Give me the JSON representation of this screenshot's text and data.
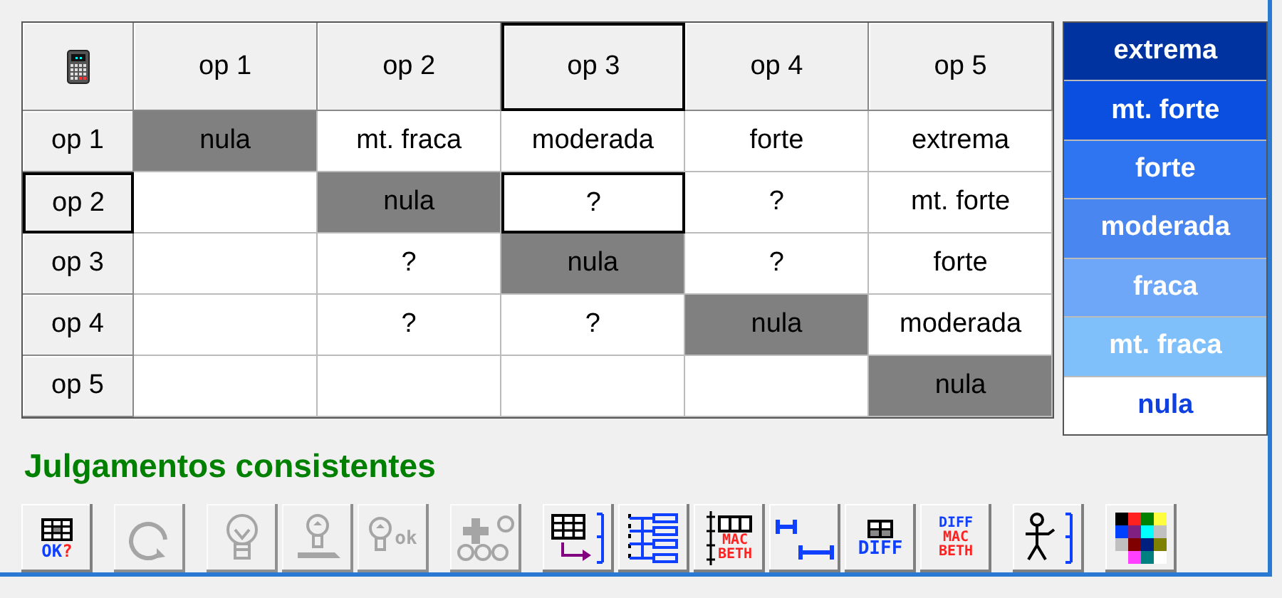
{
  "matrix": {
    "columns": [
      {
        "label": "op 1",
        "selected": false
      },
      {
        "label": "op 2",
        "selected": false
      },
      {
        "label": "op 3",
        "selected": true
      },
      {
        "label": "op 4",
        "selected": false
      },
      {
        "label": "op 5",
        "selected": false
      }
    ],
    "rows": [
      {
        "label": "op 1",
        "selected": false,
        "cells": [
          {
            "text": "nula",
            "shaded": true,
            "selected": false
          },
          {
            "text": "mt. fraca",
            "shaded": false,
            "selected": false
          },
          {
            "text": "moderada",
            "shaded": false,
            "selected": false
          },
          {
            "text": "forte",
            "shaded": false,
            "selected": false
          },
          {
            "text": "extrema",
            "shaded": false,
            "selected": false
          }
        ]
      },
      {
        "label": "op 2",
        "selected": true,
        "cells": [
          {
            "shaded": false,
            "selected": false
          },
          {
            "text": "nula",
            "shaded": true,
            "selected": false
          },
          {
            "text": "?",
            "shaded": false,
            "selected": true
          },
          {
            "text": "?",
            "shaded": false,
            "selected": false
          },
          {
            "text": "mt. forte",
            "shaded": false,
            "selected": false
          }
        ]
      },
      {
        "label": "op 3",
        "selected": false,
        "cells": [
          {
            "shaded": false,
            "selected": false
          },
          {
            "text": "?",
            "shaded": false,
            "selected": false
          },
          {
            "text": "nula",
            "shaded": true,
            "selected": false
          },
          {
            "text": "?",
            "shaded": false,
            "selected": false
          },
          {
            "text": "forte",
            "shaded": false,
            "selected": false
          }
        ]
      },
      {
        "label": "op 4",
        "selected": false,
        "cells": [
          {
            "shaded": false,
            "selected": false
          },
          {
            "text": "?",
            "shaded": false,
            "selected": false
          },
          {
            "text": "?",
            "shaded": false,
            "selected": false
          },
          {
            "text": "nula",
            "shaded": true,
            "selected": false
          },
          {
            "text": "moderada",
            "shaded": false,
            "selected": false
          }
        ]
      },
      {
        "label": "op 5",
        "selected": false,
        "cells": [
          {
            "shaded": false,
            "selected": false
          },
          {
            "shaded": false,
            "selected": false
          },
          {
            "shaded": false,
            "selected": false
          },
          {
            "shaded": false,
            "selected": false
          },
          {
            "text": "nula",
            "shaded": true,
            "selected": false
          }
        ]
      }
    ]
  },
  "scale": [
    {
      "label": "extrema",
      "color": "#0033a0"
    },
    {
      "label": "mt. forte",
      "color": "#0a4fe0"
    },
    {
      "label": "forte",
      "color": "#2f74f0"
    },
    {
      "label": "moderada",
      "color": "#4a86f0"
    },
    {
      "label": "fraca",
      "color": "#6ea6f8"
    },
    {
      "label": "mt. fraca",
      "color": "#80c0fa"
    },
    {
      "label": "nula",
      "color": "#ffffff"
    }
  ],
  "status": "Julgamentos consistentes",
  "toolbar": [
    [
      {
        "kind": "grid-ok",
        "disabled": false,
        "caption": [
          "OK",
          "?"
        ]
      }
    ],
    [
      {
        "kind": "refresh",
        "disabled": true
      }
    ],
    [
      {
        "kind": "bulb",
        "disabled": true
      },
      {
        "kind": "bulb-bar",
        "disabled": true
      },
      {
        "kind": "bulb-ok",
        "disabled": true,
        "caption": [
          "ok"
        ]
      }
    ],
    [
      {
        "kind": "plus-bulbs",
        "disabled": true
      }
    ],
    [
      {
        "kind": "grid-arrow",
        "disabled": false
      },
      {
        "kind": "tree",
        "disabled": false
      },
      {
        "kind": "macbeth-scale",
        "disabled": false,
        "caption": [
          "MAC",
          "BETH"
        ]
      },
      {
        "kind": "ranges",
        "disabled": false
      },
      {
        "kind": "diff",
        "disabled": false,
        "caption": [
          "DIFF"
        ]
      },
      {
        "kind": "diff-macbeth",
        "disabled": false,
        "caption": [
          "DIFF",
          "MAC",
          "BETH"
        ]
      }
    ],
    [
      {
        "kind": "figure",
        "disabled": false
      }
    ],
    [
      {
        "kind": "palette",
        "disabled": false
      }
    ]
  ]
}
